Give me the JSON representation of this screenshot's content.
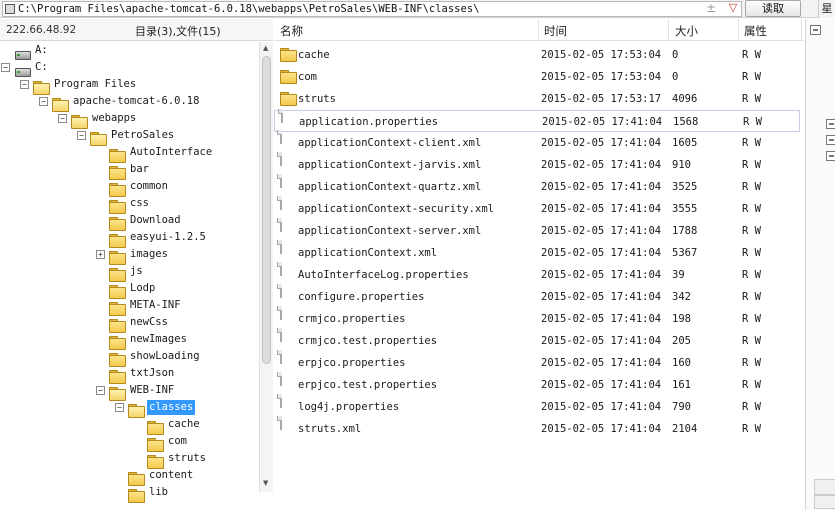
{
  "address_bar": {
    "path": "C:\\Program Files\\apache-tomcat-6.0.18\\webapps\\PetroSales\\WEB-INF\\classes\\",
    "plus_symbol": "±",
    "dropdown_symbol": "▽",
    "read_button": "读取",
    "star_tab": "星"
  },
  "left_header": {
    "server_ip": "222.66.48.92",
    "dir_count": "目录(3),文件(15)"
  },
  "tree": [
    {
      "label": "A:",
      "type": "drive",
      "depth": 0,
      "toggle": ""
    },
    {
      "label": "C:",
      "type": "drive",
      "depth": 0,
      "toggle": "-"
    },
    {
      "label": "Program Files",
      "type": "folder",
      "depth": 1,
      "toggle": "-"
    },
    {
      "label": "apache-tomcat-6.0.18",
      "type": "folder",
      "depth": 2,
      "toggle": "-"
    },
    {
      "label": "webapps",
      "type": "folder",
      "depth": 3,
      "toggle": "-"
    },
    {
      "label": "PetroSales",
      "type": "folder",
      "depth": 4,
      "toggle": "-"
    },
    {
      "label": "AutoInterface",
      "type": "folder",
      "depth": 5,
      "toggle": ""
    },
    {
      "label": "bar",
      "type": "folder",
      "depth": 5,
      "toggle": ""
    },
    {
      "label": "common",
      "type": "folder",
      "depth": 5,
      "toggle": ""
    },
    {
      "label": "css",
      "type": "folder",
      "depth": 5,
      "toggle": ""
    },
    {
      "label": "Download",
      "type": "folder",
      "depth": 5,
      "toggle": ""
    },
    {
      "label": "easyui-1.2.5",
      "type": "folder",
      "depth": 5,
      "toggle": ""
    },
    {
      "label": "images",
      "type": "folder",
      "depth": 5,
      "toggle": "+"
    },
    {
      "label": "js",
      "type": "folder",
      "depth": 5,
      "toggle": ""
    },
    {
      "label": "Lodp",
      "type": "folder",
      "depth": 5,
      "toggle": ""
    },
    {
      "label": "META-INF",
      "type": "folder",
      "depth": 5,
      "toggle": ""
    },
    {
      "label": "newCss",
      "type": "folder",
      "depth": 5,
      "toggle": ""
    },
    {
      "label": "newImages",
      "type": "folder",
      "depth": 5,
      "toggle": ""
    },
    {
      "label": "showLoading",
      "type": "folder",
      "depth": 5,
      "toggle": ""
    },
    {
      "label": "txtJson",
      "type": "folder",
      "depth": 5,
      "toggle": ""
    },
    {
      "label": "WEB-INF",
      "type": "folder",
      "depth": 5,
      "toggle": "-"
    },
    {
      "label": "classes",
      "type": "folder",
      "depth": 6,
      "toggle": "-",
      "selected": true
    },
    {
      "label": "cache",
      "type": "folder",
      "depth": 7,
      "toggle": ""
    },
    {
      "label": "com",
      "type": "folder",
      "depth": 7,
      "toggle": ""
    },
    {
      "label": "struts",
      "type": "folder",
      "depth": 7,
      "toggle": ""
    },
    {
      "label": "content",
      "type": "folder",
      "depth": 6,
      "toggle": ""
    },
    {
      "label": "lib",
      "type": "folder",
      "depth": 6,
      "toggle": ""
    }
  ],
  "list_header": {
    "name": "名称",
    "time": "时间",
    "size": "大小",
    "attr": "属性"
  },
  "files": [
    {
      "name": "cache",
      "type": "folder",
      "time": "2015-02-05 17:53:04",
      "size": "0",
      "attr": "R W"
    },
    {
      "name": "com",
      "type": "folder",
      "time": "2015-02-05 17:53:04",
      "size": "0",
      "attr": "R W"
    },
    {
      "name": "struts",
      "type": "folder",
      "time": "2015-02-05 17:53:17",
      "size": "4096",
      "attr": "R W"
    },
    {
      "name": "application.properties",
      "type": "file",
      "time": "2015-02-05 17:41:04",
      "size": "1568",
      "attr": "R W",
      "hover": true
    },
    {
      "name": "applicationContext-client.xml",
      "type": "file",
      "time": "2015-02-05 17:41:04",
      "size": "1605",
      "attr": "R W"
    },
    {
      "name": "applicationContext-jarvis.xml",
      "type": "file",
      "time": "2015-02-05 17:41:04",
      "size": "910",
      "attr": "R W"
    },
    {
      "name": "applicationContext-quartz.xml",
      "type": "file",
      "time": "2015-02-05 17:41:04",
      "size": "3525",
      "attr": "R W"
    },
    {
      "name": "applicationContext-security.xml",
      "type": "file",
      "time": "2015-02-05 17:41:04",
      "size": "3555",
      "attr": "R W"
    },
    {
      "name": "applicationContext-server.xml",
      "type": "file",
      "time": "2015-02-05 17:41:04",
      "size": "1788",
      "attr": "R W"
    },
    {
      "name": "applicationContext.xml",
      "type": "file",
      "time": "2015-02-05 17:41:04",
      "size": "5367",
      "attr": "R W"
    },
    {
      "name": "AutoInterfaceLog.properties",
      "type": "file",
      "time": "2015-02-05 17:41:04",
      "size": "39",
      "attr": "R W"
    },
    {
      "name": "configure.properties",
      "type": "file",
      "time": "2015-02-05 17:41:04",
      "size": "342",
      "attr": "R W"
    },
    {
      "name": "crmjco.properties",
      "type": "file",
      "time": "2015-02-05 17:41:04",
      "size": "198",
      "attr": "R W"
    },
    {
      "name": "crmjco.test.properties",
      "type": "file",
      "time": "2015-02-05 17:41:04",
      "size": "205",
      "attr": "R W"
    },
    {
      "name": "erpjco.properties",
      "type": "file",
      "time": "2015-02-05 17:41:04",
      "size": "160",
      "attr": "R W"
    },
    {
      "name": "erpjco.test.properties",
      "type": "file",
      "time": "2015-02-05 17:41:04",
      "size": "161",
      "attr": "R W"
    },
    {
      "name": "log4j.properties",
      "type": "file",
      "time": "2015-02-05 17:41:04",
      "size": "790",
      "attr": "R W"
    },
    {
      "name": "struts.xml",
      "type": "file",
      "time": "2015-02-05 17:41:04",
      "size": "2104",
      "attr": "R W"
    }
  ]
}
